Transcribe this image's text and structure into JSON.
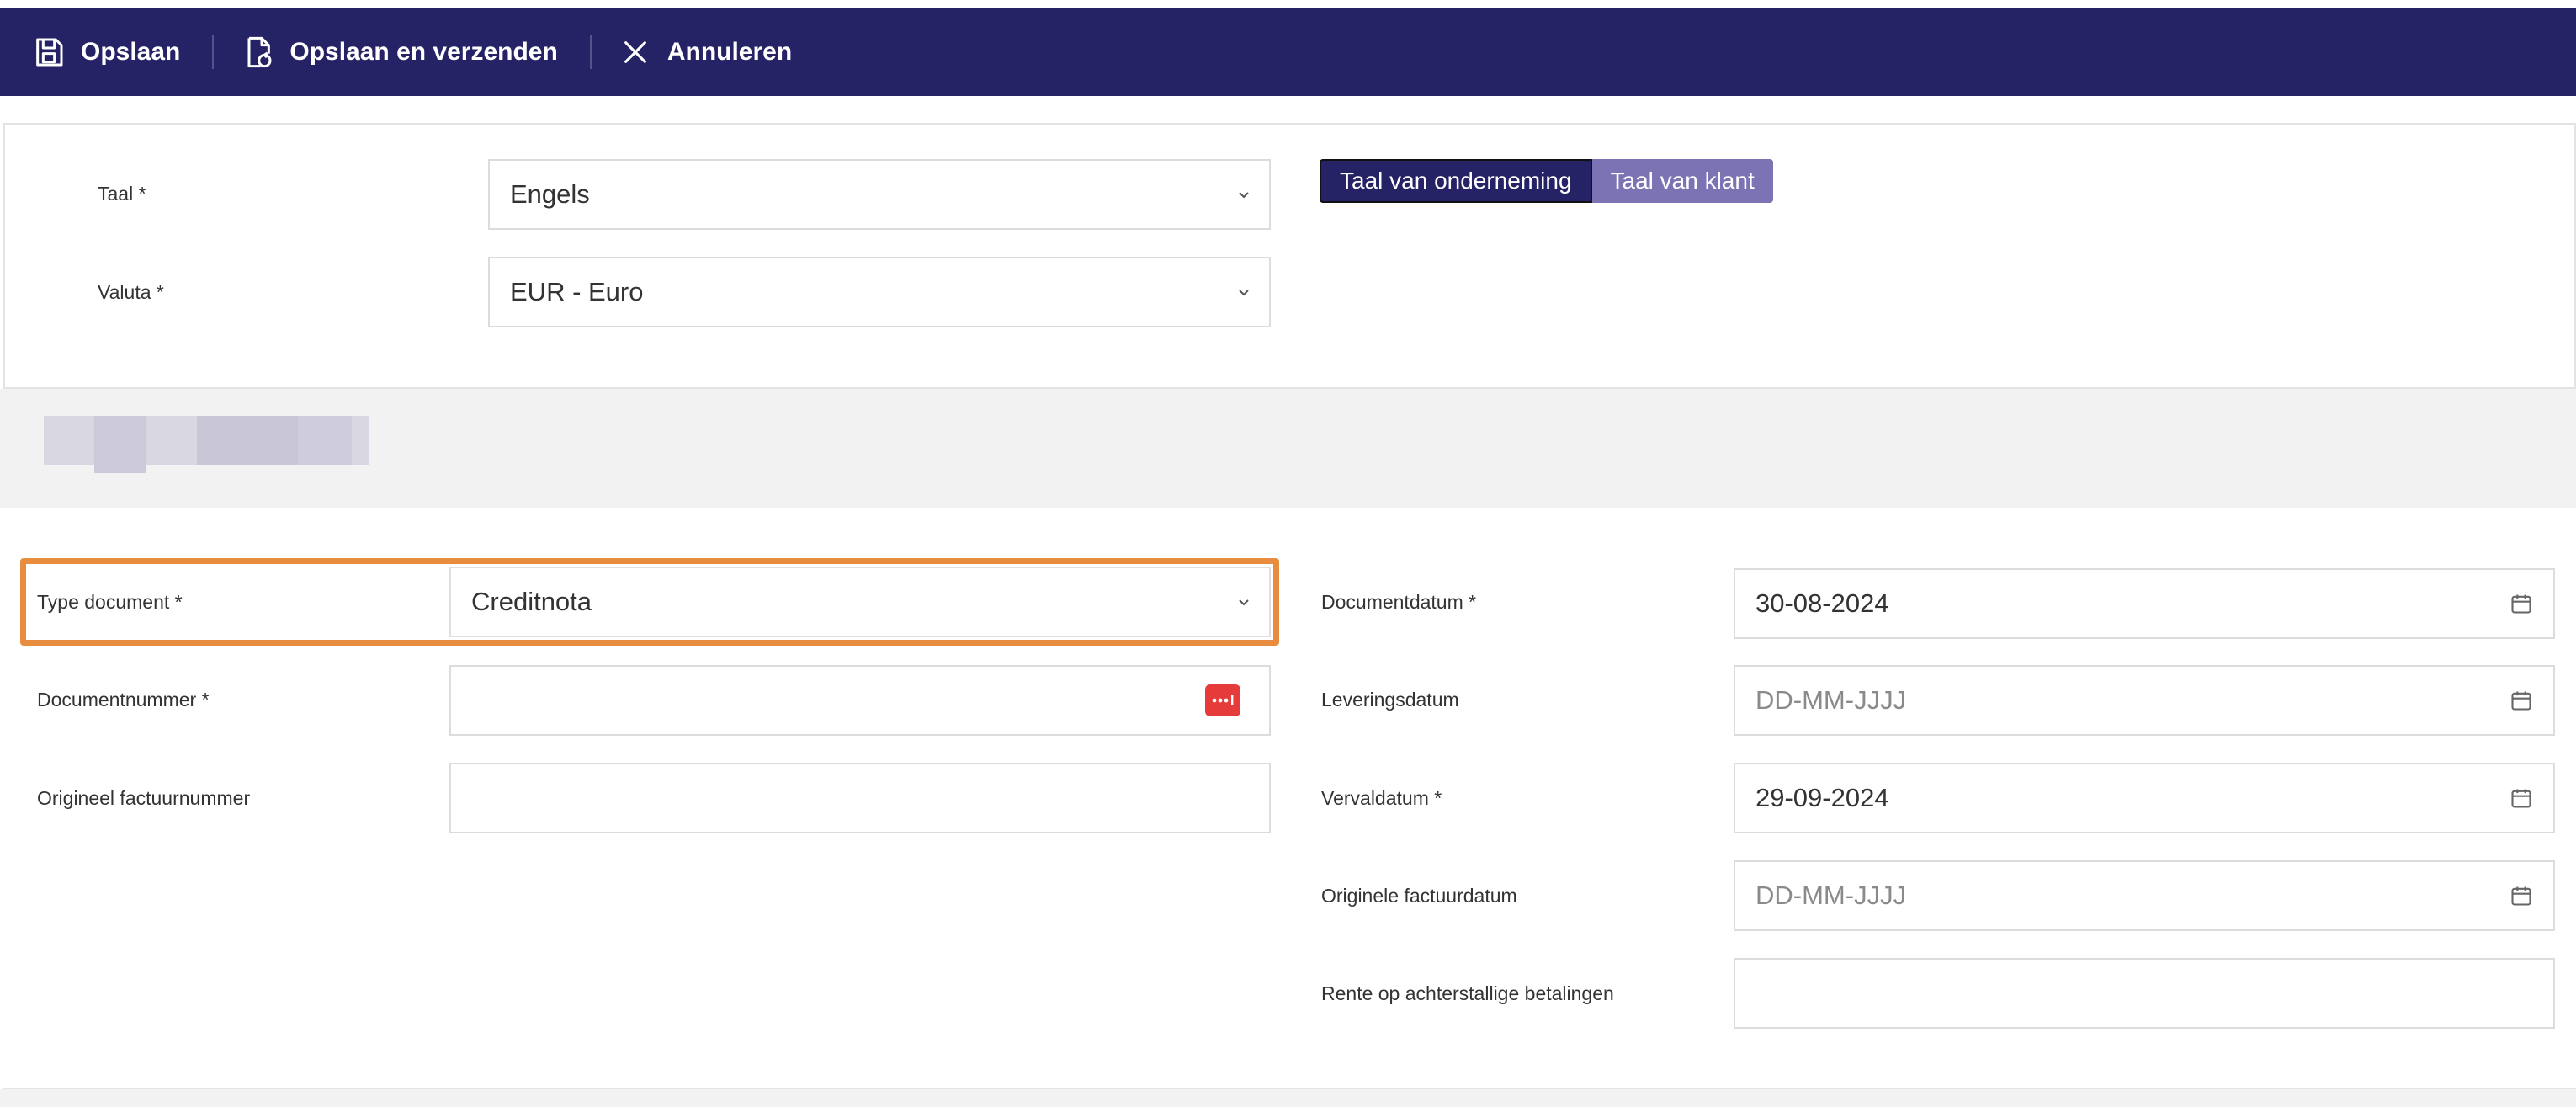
{
  "toolbar": {
    "save_label": "Opslaan",
    "save_send_label": "Opslaan en verzenden",
    "cancel_label": "Annuleren",
    "background": "#262266"
  },
  "general": {
    "language": {
      "label": "Taal *",
      "value": "Engels"
    },
    "currency": {
      "label": "Valuta *",
      "value": "EUR - Euro"
    },
    "language_toggle": {
      "options": [
        "Taal van onderneming",
        "Taal van klant"
      ],
      "selected": "Taal van onderneming"
    }
  },
  "document": {
    "type": {
      "label": "Type document *",
      "value": "Creditnota"
    },
    "number": {
      "label": "Documentnummer *",
      "value": ""
    },
    "original_invoice_number": {
      "label": "Origineel factuurnummer",
      "value": ""
    },
    "document_date": {
      "label": "Documentdatum *",
      "value": "30-08-2024"
    },
    "delivery_date": {
      "label": "Leveringsdatum",
      "placeholder": "DD-MM-JJJJ"
    },
    "due_date": {
      "label": "Vervaldatum *",
      "value": "29-09-2024"
    },
    "original_invoice_date": {
      "label": "Originele factuurdatum",
      "placeholder": "DD-MM-JJJJ"
    },
    "late_interest": {
      "label": "Rente op achterstallige betalingen",
      "value": ""
    }
  },
  "colors": {
    "accent": "#262266",
    "toggle_inactive": "#7b73b3",
    "highlight": "#e88c3f",
    "generate_button": "#e53b3b"
  },
  "icons": [
    "save-icon",
    "save-send-icon",
    "close-icon",
    "chevron-down-icon",
    "calendar-icon",
    "generate-number-icon"
  ]
}
